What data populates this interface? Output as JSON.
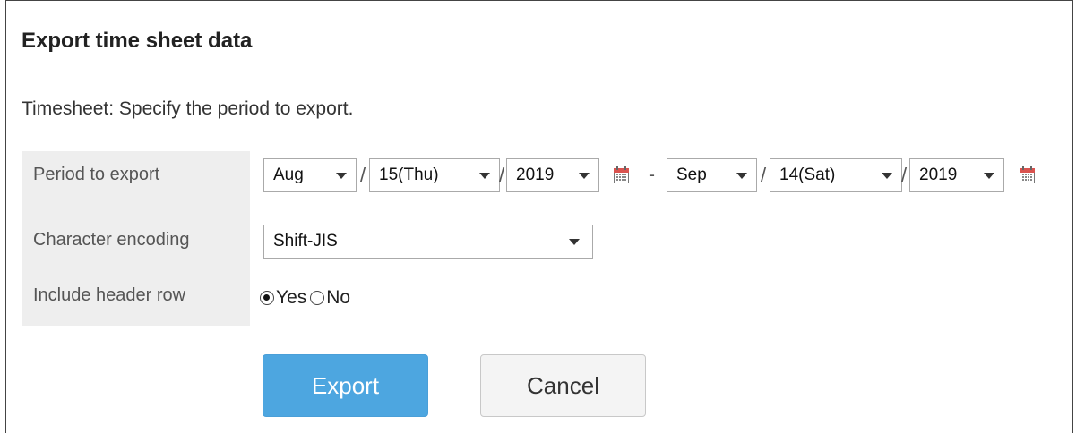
{
  "dialog": {
    "title": "Export time sheet data",
    "description": "Timesheet: Specify the period to export."
  },
  "form": {
    "period": {
      "label": "Period to export",
      "start": {
        "month": "Aug",
        "day": "15(Thu)",
        "year": "2019"
      },
      "separator": "-",
      "end": {
        "month": "Sep",
        "day": "14(Sat)",
        "year": "2019"
      },
      "date_divider": "/"
    },
    "encoding": {
      "label": "Character encoding",
      "value": "Shift-JIS"
    },
    "header_row": {
      "label": "Include header row",
      "options": [
        {
          "label": "Yes",
          "checked": true
        },
        {
          "label": "No",
          "checked": false
        }
      ]
    }
  },
  "buttons": {
    "export_label": "Export",
    "cancel_label": "Cancel"
  },
  "icons": {
    "calendar": "calendar-icon",
    "dropdown": "chevron-down-icon",
    "radio": "radio-icon"
  },
  "colors": {
    "primary_button": "#4da6e0",
    "label_background": "#eeeeee",
    "calendar_header": "#d9534f"
  }
}
